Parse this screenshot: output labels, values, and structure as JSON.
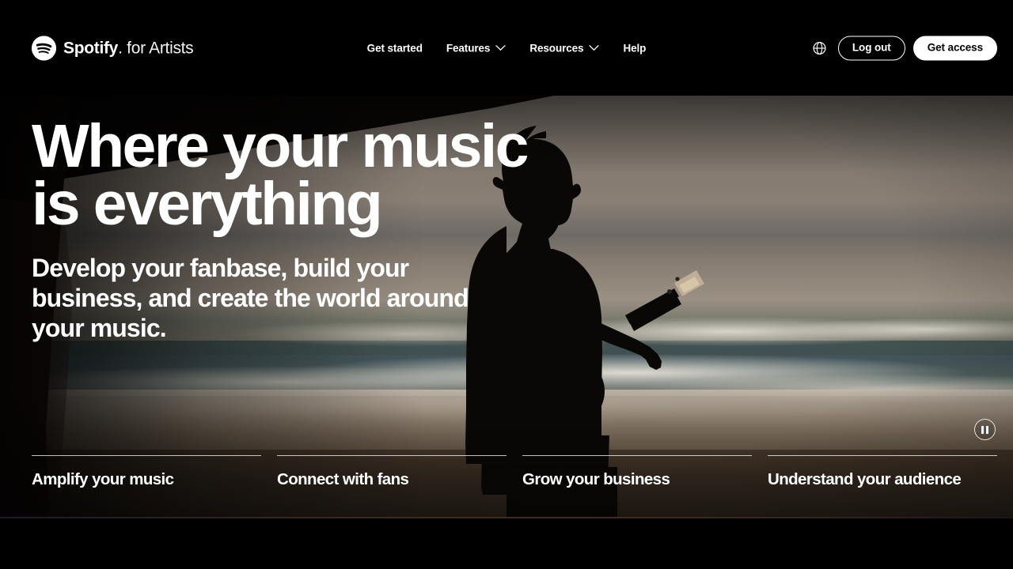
{
  "header": {
    "brand": {
      "icon": "spotify-logo-icon",
      "name_bold": "Spotify",
      "name_light": "for Artists"
    },
    "nav": [
      {
        "label": "Get started",
        "has_chevron": false,
        "icon": ""
      },
      {
        "label": "Features",
        "has_chevron": true,
        "icon": "chevron-down-icon"
      },
      {
        "label": "Resources",
        "has_chevron": true,
        "icon": "chevron-down-icon"
      },
      {
        "label": "Help",
        "has_chevron": false,
        "icon": ""
      }
    ],
    "language_icon": "globe-icon",
    "logout_label": "Log out",
    "get_access_label": "Get access"
  },
  "hero": {
    "headline_line1": "Where your music",
    "headline_line2": "is everything",
    "subhead": "Develop your fanbase, build your business, and create the world around your music.",
    "media_control": {
      "icon": "pause-icon",
      "state": "playing"
    },
    "image_alt": "Silhouette of a guitarist on a beach at sunset seen from inside a cave"
  },
  "tabs": [
    {
      "label": "Amplify your music"
    },
    {
      "label": "Connect with fans"
    },
    {
      "label": "Grow your business"
    },
    {
      "label": "Understand your audience"
    }
  ],
  "colors": {
    "background": "#000000",
    "text_primary": "#ffffff",
    "accent_button": "#ffffff",
    "sky": "#8a8076",
    "ocean": "#46575b",
    "sand": "#3b2f24"
  }
}
